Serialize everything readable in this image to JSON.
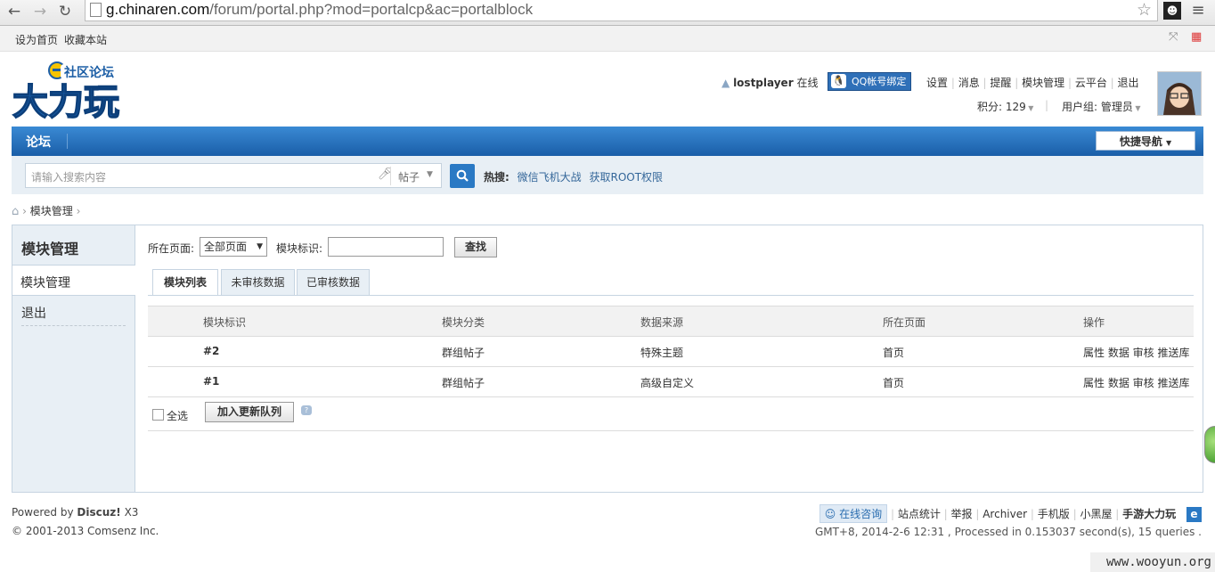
{
  "browser": {
    "url_host": "g.chinaren.com",
    "url_path": "/forum/portal.php?mod=portalcp&ac=portalblock",
    "icons": [
      "back-icon",
      "forward-icon",
      "reload-icon",
      "star-icon",
      "menu-icon"
    ]
  },
  "topbar": {
    "set_home": "设为首页",
    "bookmark": "收藏本站"
  },
  "header": {
    "logo_top": "社区论坛",
    "logo_main": "大力玩",
    "username": "lostplayer",
    "status": "在线",
    "qq_bind": "QQ帐号绑定",
    "links": [
      "设置",
      "消息",
      "提醒",
      "模块管理",
      "云平台",
      "退出"
    ],
    "points": "积分: 129",
    "usergroup": "用户组: 管理员"
  },
  "nav": {
    "forum": "论坛",
    "quick_nav": "快捷导航"
  },
  "search": {
    "placeholder": "请输入搜索内容",
    "type": "帖子",
    "hot_label": "热搜:",
    "hot_keywords": [
      "微信飞机大战",
      "获取ROOT权限"
    ]
  },
  "breadcrumb": {
    "current": "模块管理"
  },
  "sidebar": {
    "title": "模块管理",
    "items": [
      "模块管理",
      "退出"
    ]
  },
  "filter": {
    "page_label": "所在页面:",
    "page_value": "全部页面",
    "block_label": "模块标识:",
    "find_button": "查找"
  },
  "tabs": [
    "模块列表",
    "未审核数据",
    "已审核数据"
  ],
  "table": {
    "headers": [
      "模块标识",
      "模块分类",
      "数据来源",
      "所在页面",
      "操作"
    ],
    "rows": [
      {
        "id": "#2",
        "category": "群组帖子",
        "source": "特殊主题",
        "page": "首页",
        "ops": "属性 数据 审核 推送库"
      },
      {
        "id": "#1",
        "category": "群组帖子",
        "source": "高级自定义",
        "page": "首页",
        "ops": "属性 数据 审核 推送库"
      }
    ]
  },
  "table_footer": {
    "select_all": "全选",
    "queue_button": "加入更新队列"
  },
  "footer": {
    "powered": "Powered by",
    "brand": "Discuz!",
    "version": "X3",
    "copyright": "© 2001-2013 Comsenz Inc.",
    "consult": "在线咨询",
    "links": [
      "站点统计",
      "举报",
      "Archiver",
      "手机版",
      "小黑屋",
      "手游大力玩"
    ],
    "time": "GMT+8, 2014-2-6 12:31 , Processed in 0.153037 second(s), 15 queries ."
  },
  "watermark": "www.wooyun.org",
  "colors": {
    "nav_blue": "#2a79c4",
    "side_bg": "#e8eff5",
    "border": "#c6d4e1"
  }
}
